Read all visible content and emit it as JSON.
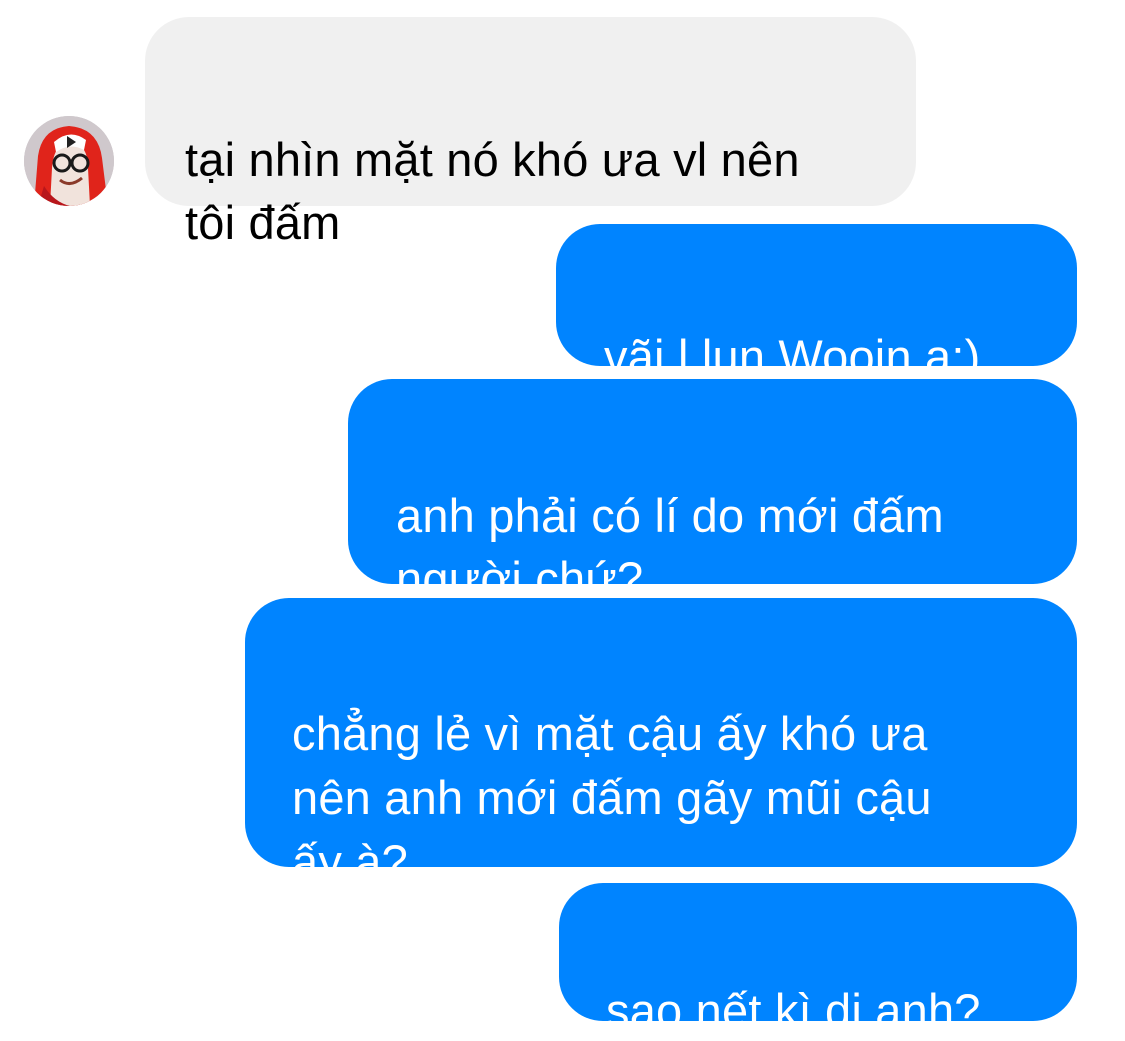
{
  "conversation": {
    "contact_avatar_icon": "person-avatar-red-hood",
    "colors": {
      "incoming_bubble": "#f0f0f0",
      "outgoing_bubble": "#0084ff",
      "incoming_text": "#000000",
      "outgoing_text": "#ffffff"
    },
    "messages": [
      {
        "direction": "incoming",
        "text": "tại nhìn mặt nó khó ưa vl nên\ntôi đấm"
      },
      {
        "direction": "outgoing",
        "text": "vãi l lun Wooin ạ:)"
      },
      {
        "direction": "outgoing",
        "text": "anh phải có lí do mới đấm\nngười chứ?"
      },
      {
        "direction": "outgoing",
        "text": "chẳng lẻ vì mặt cậu ấy khó ưa\nnên anh mới đấm gãy mũi cậu\nấy à?"
      },
      {
        "direction": "outgoing",
        "text": "sao nết kì dị anh?"
      }
    ]
  }
}
